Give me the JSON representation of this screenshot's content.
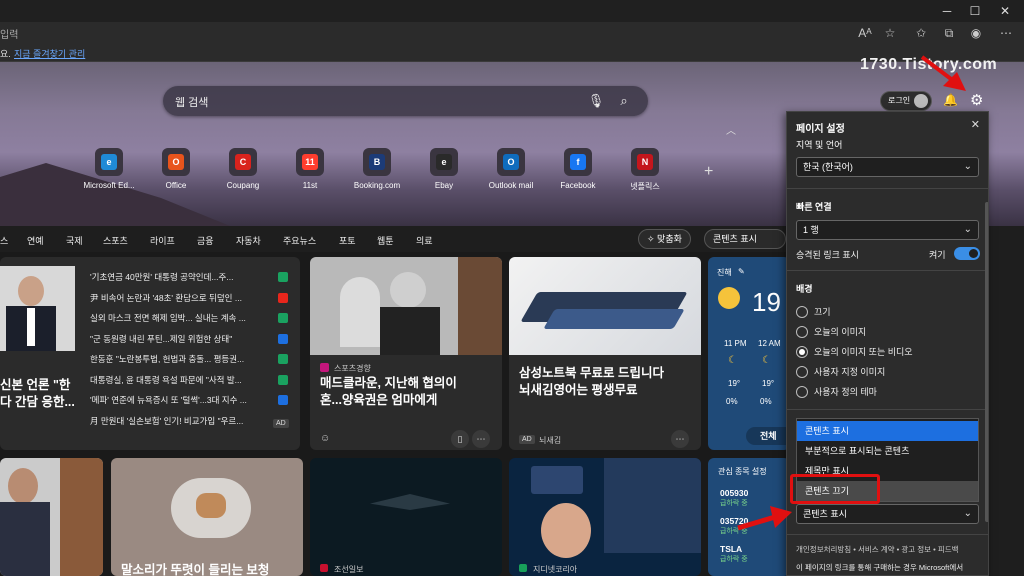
{
  "browser": {
    "addr_placeholder": "입력",
    "fav_bar_text": "지금 즐겨찾기 관리",
    "fav_bar_prefix": "요."
  },
  "watermark": "1730.Tistory.com",
  "search": {
    "placeholder": "웹 검색"
  },
  "header": {
    "login_label": "로그인"
  },
  "quicklinks": [
    {
      "label": "Microsoft Ed...",
      "color": "#1f8ad6",
      "glyph": "e"
    },
    {
      "label": "Office",
      "color": "#e8541c",
      "glyph": "O"
    },
    {
      "label": "Coupang",
      "color": "#d9231d",
      "glyph": "C"
    },
    {
      "label": "11st",
      "color": "#ff3d2e",
      "glyph": "11"
    },
    {
      "label": "Booking.com",
      "color": "#1c3b78",
      "glyph": "B"
    },
    {
      "label": "Ebay",
      "color": "#2a2a2a",
      "glyph": "e"
    },
    {
      "label": "Outlook mail",
      "color": "#0f6cbd",
      "glyph": "O"
    },
    {
      "label": "Facebook",
      "color": "#1877f2",
      "glyph": "f"
    },
    {
      "label": "넷플릭스",
      "color": "#c4161c",
      "glyph": "N"
    }
  ],
  "nav": {
    "items": [
      "스",
      "연예",
      "국제",
      "스포츠",
      "라이프",
      "금융",
      "자동차",
      "주요뉴스",
      "포토",
      "웹툰",
      "의료"
    ],
    "personalize": "맞춤화",
    "content_show": "콘텐츠 표시"
  },
  "feed": {
    "left_headline": [
      "신본 언론 \"한",
      "다 간담 응한..."
    ],
    "list": [
      {
        "text": "'기초연금 40만원' 대통령 공약인데...주...",
        "icon_color": "#1aa260"
      },
      {
        "text": "尹 비속어 논란과 '48초' 환담으로 뒤덮인 ...",
        "icon_color": "#e8261c"
      },
      {
        "text": "실외 마스크 전면 해제 임박... 실내는 계속 ...",
        "icon_color": "#1aa260"
      },
      {
        "text": "\"군 동원령 내린 푸틴...제일 위험한 상태\"",
        "icon_color": "#1d6fe0"
      },
      {
        "text": "한동훈 \"노란봉투법, 헌법과 충돌... 평등권...",
        "icon_color": "#1aa260"
      },
      {
        "text": "대통령실, 윤 대통령 욕설 파문에 \"사적 발...",
        "icon_color": "#1aa260"
      },
      {
        "text": "'메파' 연준에 뉴욕증시 또 '털썩'...3대 지수 ...",
        "icon_color": "#1d6fe0"
      },
      {
        "text": "月 만원대 '실손보험' 인기! 비교가입 \"우르...",
        "icon_color": "#555555"
      }
    ],
    "ad_label": "AD",
    "card2": {
      "source": "스포츠경향",
      "headline": [
        "매드클라운, 지난해 협의이",
        "혼...양육권은 엄마에게"
      ]
    },
    "card3": {
      "headline": [
        "삼성노트북 무료로 드립니다",
        "뇌새김영어는 평생무료"
      ],
      "ad": "AD",
      "source": "뇌새김"
    },
    "weather": {
      "title": "진해",
      "temp": "19",
      "hours": [
        "11 PM",
        "12 AM"
      ],
      "temps": [
        "19°",
        "19°"
      ],
      "rain": [
        "0%",
        "0%"
      ],
      "full_btn": "전체 "
    },
    "stocks": {
      "title": "관심 종목 설정",
      "items": [
        {
          "code": "005930",
          "status": "급하락 중"
        },
        {
          "code": "035720",
          "status": "급하락 중"
        },
        {
          "code": "TSLA",
          "status": "급하락 중"
        }
      ]
    },
    "bottom": [
      {
        "headline": "말소리가 뚜렷이 들리는 보청"
      },
      {
        "source": "조선일보"
      },
      {
        "source": "지디넷코리아"
      }
    ]
  },
  "panel": {
    "title": "페이지 설정",
    "lang_section": "지역 및 언어",
    "lang_value": "한국 (한국어)",
    "quick_section": "빠른 연결",
    "quick_value": "1 행",
    "promoted_label": "승격된 링크 표시",
    "promoted_state": "켜기",
    "bg_section": "배경",
    "bg_options": [
      {
        "label": "끄기",
        "on": false
      },
      {
        "label": "오늘의 이미지",
        "on": false
      },
      {
        "label": "오늘의 이미지 또는 비디오",
        "on": true
      },
      {
        "label": "사용자 지정 이미지",
        "on": false
      },
      {
        "label": "사용자 정의 테마",
        "on": false
      }
    ],
    "content_options": [
      {
        "label": "콘텐츠 표시",
        "state": "selected"
      },
      {
        "label": "부분적으로 표시되는 콘텐츠",
        "state": "normal"
      },
      {
        "label": "제목만 표시",
        "state": "normal"
      },
      {
        "label": "콘텐츠 끄기",
        "state": "hover"
      }
    ],
    "content_select": "콘텐츠 표시",
    "footer_links": "개인정보처리방침 • 서비스 계약 • 광고 정보 • 피드백",
    "footer_note": "이 페이지의 링크를 통해 구매하는 경우 Microsoft에서"
  },
  "colors": {
    "accent": "#3a8ee6",
    "selected": "#1d6fe0",
    "highlight_red": "#e01010"
  }
}
